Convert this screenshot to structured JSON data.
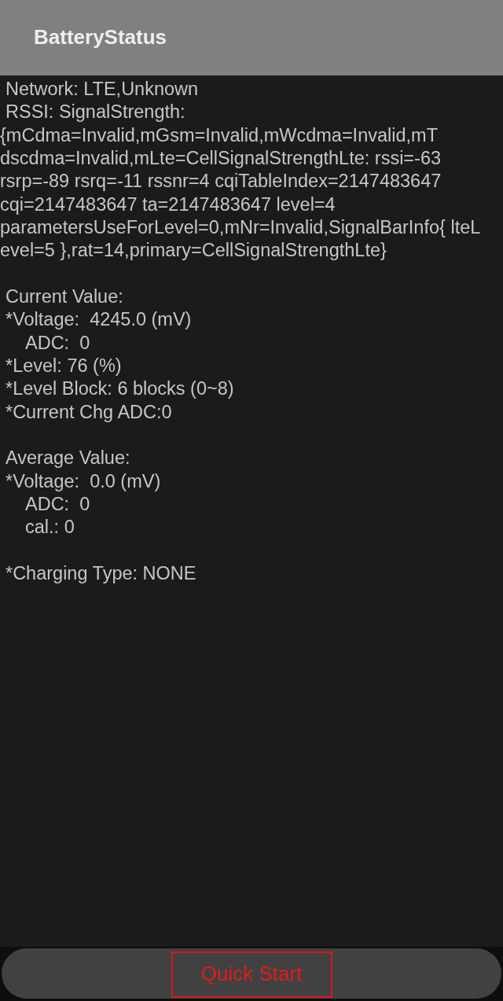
{
  "app_bar": {
    "title": "BatteryStatus"
  },
  "sections": [
    {
      "items": [
        {
          "kind": "line",
          "text": "Network: LTE,Unknown"
        },
        {
          "kind": "wrapped",
          "lines": [
            "RSSI: SignalStrength:",
            "{mCdma=Invalid,mGsm=Invalid,mWcdma=Invalid,mT",
            "dscdma=Invalid,mLte=CellSignalStrengthLte: rssi=-63",
            "rsrp=-89 rsrq=-11 rssnr=4 cqiTableIndex=2147483647",
            "cqi=2147483647 ta=2147483647 level=4",
            "parametersUseForLevel=0,mNr=Invalid,SignalBarInfo{ lteL",
            "evel=5 },rat=14,primary=CellSignalStrengthLte}"
          ]
        }
      ]
    },
    {
      "items": [
        {
          "kind": "line",
          "text": "Current Value:"
        },
        {
          "kind": "line",
          "text": "*Voltage:  4245.0 (mV)"
        },
        {
          "kind": "sub",
          "text": "ADC:  0"
        },
        {
          "kind": "line",
          "text": "*Level: 76 (%)"
        },
        {
          "kind": "line",
          "text": "*Level Block: 6 blocks (0~8)"
        },
        {
          "kind": "line",
          "text": "*Current Chg ADC:0"
        }
      ]
    },
    {
      "items": [
        {
          "kind": "line",
          "text": "Average Value:"
        },
        {
          "kind": "line",
          "text": "*Voltage:  0.0 (mV)"
        },
        {
          "kind": "sub",
          "text": "ADC:  0"
        },
        {
          "kind": "sub",
          "text": "cal.: 0"
        }
      ]
    },
    {
      "items": [
        {
          "kind": "line",
          "text": "*Charging Type: NONE"
        }
      ]
    }
  ],
  "bottom_bar": {
    "button": "Quick Start"
  }
}
